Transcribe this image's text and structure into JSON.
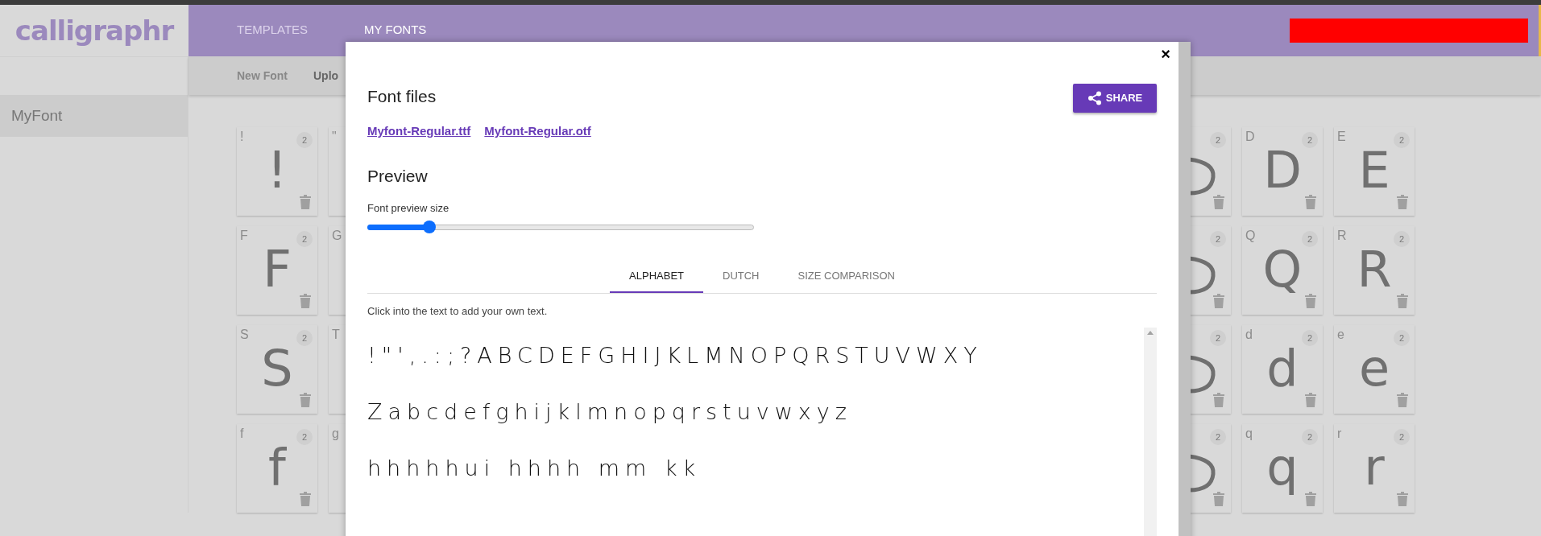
{
  "logo": "calligraphr",
  "nav": [
    {
      "label": "TEMPLATES",
      "selected": false
    },
    {
      "label": "MY FONTS",
      "selected": true
    }
  ],
  "subnav": [
    {
      "label": "New Font"
    },
    {
      "label": "Uplo"
    }
  ],
  "sidebar": {
    "items": [
      {
        "label": "MyFont",
        "selected": true
      }
    ]
  },
  "glyph_rows": [
    {
      "left": [
        {
          "label": "!",
          "glyph": "!",
          "count": "2"
        },
        {
          "label": "\""
        }
      ],
      "right": [
        {
          "count": "2"
        },
        {
          "label": "D",
          "glyph": "D",
          "count": "2"
        },
        {
          "label": "E",
          "glyph": "E",
          "count": "2"
        }
      ]
    },
    {
      "left": [
        {
          "label": "F",
          "glyph": "F",
          "count": "2"
        },
        {
          "label": "G"
        }
      ],
      "right": [
        {
          "count": "2"
        },
        {
          "label": "Q",
          "glyph": "Q",
          "count": "2"
        },
        {
          "label": "R",
          "glyph": "R",
          "count": "2"
        }
      ]
    },
    {
      "left": [
        {
          "label": "S",
          "glyph": "S",
          "count": "2"
        },
        {
          "label": "T"
        }
      ],
      "right": [
        {
          "count": "2"
        },
        {
          "label": "d",
          "glyph": "d",
          "count": "2"
        },
        {
          "label": "e",
          "glyph": "e",
          "count": "2"
        }
      ]
    },
    {
      "left": [
        {
          "label": "f",
          "glyph": "f",
          "count": "2"
        },
        {
          "label": "g"
        }
      ],
      "right": [
        {
          "count": "2"
        },
        {
          "label": "q",
          "glyph": "q",
          "count": "2"
        },
        {
          "label": "r",
          "glyph": "r",
          "count": "2"
        }
      ]
    }
  ],
  "modal": {
    "close": "×",
    "title": "Font files",
    "share": "SHARE",
    "files": [
      "Myfont-Regular.ttf",
      "Myfont-Regular.otf"
    ],
    "preview_title": "Preview",
    "slider_label": "Font preview size",
    "slider": {
      "level": 0.16
    },
    "tabs": [
      {
        "label": "ALPHABET",
        "selected": true
      },
      {
        "label": "DUTCH",
        "selected": false
      },
      {
        "label": "SIZE COMPARISON",
        "selected": false
      }
    ],
    "hint": "Click into the text to add your own text.",
    "preview_lines": [
      "!\"',.:;?ABCDEFGHIJKLMNOPQRSTUVWXY",
      "Zabcdefghijklmnopqrstuvwxyz",
      "hhhhhui hhhh mm kk"
    ]
  }
}
